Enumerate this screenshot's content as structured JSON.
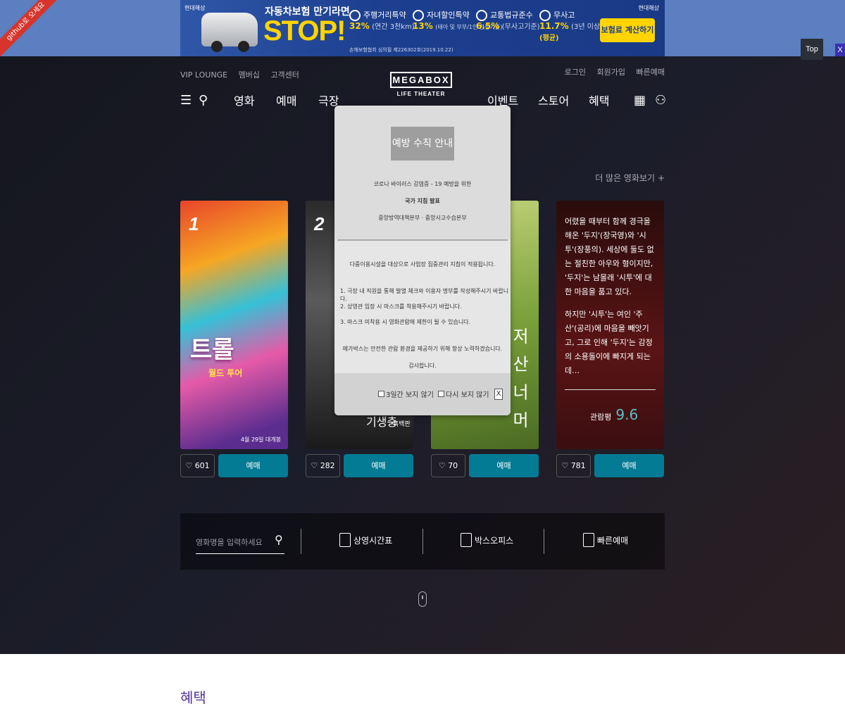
{
  "banner": {
    "brand_small": "현대해상",
    "headline": "자동차보험 만기라면",
    "stop": "STOP!",
    "note": "손해보험협회 심의필 제226302호(2019.10.22)",
    "items": [
      {
        "title": "주행거리특약",
        "pct": "32%",
        "sub": "(연간 3천km)"
      },
      {
        "title": "자녀할인특약",
        "pct": "13%",
        "sub": "(태아 및 부부/1인 한정기준)"
      },
      {
        "title": "교통법규준수",
        "pct": "6.5%",
        "sub": "(무사고기준)"
      },
      {
        "title": "무사고",
        "pct": "11.7%",
        "sub": "(3년 이상)",
        "extra": "(평균)"
      }
    ],
    "cta": "보험료 계산하기",
    "brand_right": "현대해상"
  },
  "ribbon": "github로 오세요",
  "top_button": "Top",
  "close_x": "X",
  "header": {
    "util_left": [
      "VIP LOUNGE",
      "멤버십",
      "고객센터"
    ],
    "util_right": [
      "로그인",
      "회원가입",
      "빠른예매"
    ],
    "logo": "MEGABOX",
    "logo_sub": "LIFE THEATER",
    "nav_left": [
      "영화",
      "예매",
      "극장"
    ],
    "nav_right": [
      "이벤트",
      "스토어",
      "혜택"
    ]
  },
  "more_movies": "더 많은 영화보기",
  "movies": [
    {
      "rank": "1",
      "title": "트롤",
      "subtitle": "월드 투어",
      "date": "4월 29일 대개봉",
      "likes": "601",
      "book": "예매"
    },
    {
      "rank": "2",
      "title": "기생충",
      "subtitle": "흑백판",
      "likes": "282",
      "book": "예매"
    },
    {
      "title": "저 산 너 머",
      "likes": "70",
      "book": "예매"
    },
    {
      "synopsis": [
        "어렸을 때부터 함께 경극을 해온 '두지'(장국영)와 '시투'(장풍의). 세상에 둘도 없는 절친한 아우와 형이지만, '두지'는 남몰래 '시투'에 대한 마음을 품고 있다.",
        "하지만 '시투'는 여인 '주산'(공리)에 마음을 빼앗기고, 그로 인해 '두지'는 감정의 소용돌이에 빠지게 되는데…"
      ],
      "rating_label": "관람평",
      "rating": "9.6",
      "likes": "781",
      "book": "예매"
    }
  ],
  "quick": {
    "search_placeholder": "영화명을 입력하세요",
    "links": [
      "상영시간표",
      "박스오피스",
      "빠른예매"
    ]
  },
  "benefit_title": "혜택",
  "modal": {
    "title": "예방 수칙 안내",
    "line1": "코로나 바이러스 감염증 - 19 예방을 위한",
    "line2": "국가 지침 발표",
    "line3": "중앙방역대책본부 · 중앙사고수습본부",
    "body1": "다중이용시설을 대상으로 사업장 집중관리 지침이 적용됩니다.",
    "rules": [
      "1. 극장 내 직원을 통해 발열 체크와 이용자 명부를 작성해주시기 바랍니다.",
      "2. 상영관 입장 시 마스크를 착용해주시기 바랍니다.",
      "3. 마스크 미착용 시 영화관람에 제한이 될 수 있습니다."
    ],
    "body2": "메가박스는 안전한 관람 환경을 제공하기 위해 항상 노력하겠습니다.",
    "thanks": "감사합니다.",
    "chk1": "3일간 보지 않기",
    "chk2": "다시 보지 않기",
    "close": "X"
  }
}
